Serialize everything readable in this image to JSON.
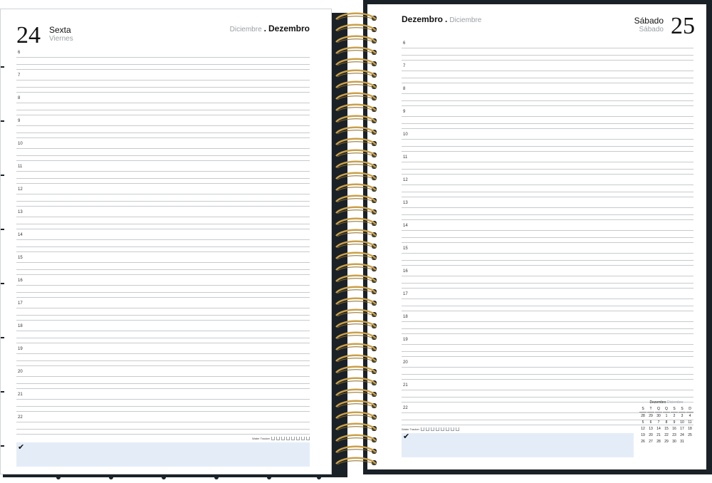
{
  "left": {
    "day_number": "24",
    "weekday_pt": "Sexta",
    "weekday_es": "Viernes",
    "month_es": "Diciembre",
    "month_sep": ".",
    "month_pt": "Dezembro",
    "hours": [
      "6",
      "7",
      "8",
      "9",
      "10",
      "11",
      "12",
      "13",
      "14",
      "15",
      "16",
      "17",
      "18",
      "19",
      "20",
      "21",
      "22"
    ],
    "water_label": "Water Tracker"
  },
  "right": {
    "day_number": "25",
    "weekday_pt": "Sábado",
    "weekday_es": "Sábado",
    "month_pt": "Dezembro",
    "month_sep": ".",
    "month_es": "Diciembre",
    "hours": [
      "6",
      "7",
      "8",
      "9",
      "10",
      "11",
      "12",
      "13",
      "14",
      "15",
      "16",
      "17",
      "18",
      "19",
      "20",
      "21",
      "22"
    ],
    "water_label": "Water Tracker",
    "mini_calendar": {
      "title_pt": "Dezembro",
      "title_es": "Diciembre",
      "weekdays": [
        "S",
        "T",
        "Q",
        "Q",
        "S",
        "S",
        "D"
      ],
      "rows": [
        [
          "28",
          "29",
          "30",
          "1",
          "2",
          "3",
          "4"
        ],
        [
          "5",
          "6",
          "7",
          "8",
          "9",
          "10",
          "11"
        ],
        [
          "12",
          "13",
          "14",
          "15",
          "16",
          "17",
          "18"
        ],
        [
          "19",
          "20",
          "21",
          "22",
          "23",
          "24",
          "25"
        ],
        [
          "26",
          "27",
          "28",
          "29",
          "30",
          "31",
          ""
        ]
      ]
    }
  },
  "check_glyph": "✔",
  "colors": {
    "cover": "#1a2127",
    "ring": "#c9a04a",
    "todo": "#e4edf7",
    "rule": "#c7cbce"
  }
}
